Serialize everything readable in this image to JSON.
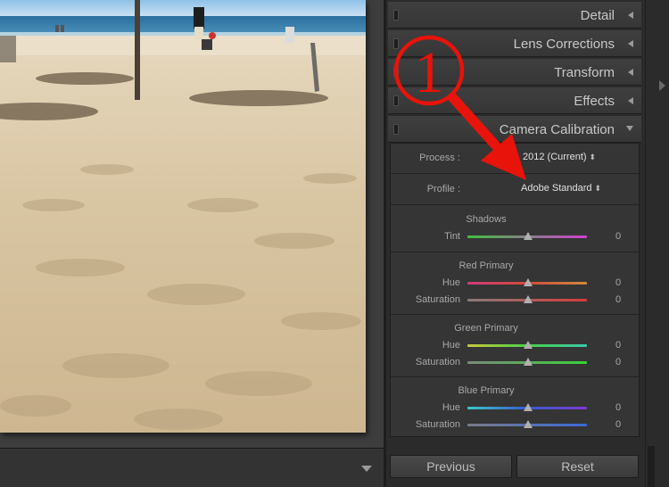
{
  "panel": {
    "sections": [
      {
        "title": "Detail",
        "state": "collapsed"
      },
      {
        "title": "Lens Corrections",
        "state": "collapsed"
      },
      {
        "title": "Transform",
        "state": "collapsed"
      },
      {
        "title": "Effects",
        "state": "collapsed"
      },
      {
        "title": "Camera Calibration",
        "state": "expanded"
      }
    ],
    "calibration": {
      "process": {
        "label": "Process :",
        "value": "2012 (Current)"
      },
      "profile": {
        "label": "Profile :",
        "value": "Adobe Standard"
      },
      "shadows": {
        "title": "Shadows",
        "tint": {
          "label": "Tint",
          "value": "0"
        }
      },
      "red_primary": {
        "title": "Red Primary",
        "hue": {
          "label": "Hue",
          "value": "0"
        },
        "saturation": {
          "label": "Saturation",
          "value": "0"
        }
      },
      "green_primary": {
        "title": "Green Primary",
        "hue": {
          "label": "Hue",
          "value": "0"
        },
        "saturation": {
          "label": "Saturation",
          "value": "0"
        }
      },
      "blue_primary": {
        "title": "Blue Primary",
        "hue": {
          "label": "Hue",
          "value": "0"
        },
        "saturation": {
          "label": "Saturation",
          "value": "0"
        }
      }
    },
    "buttons": {
      "previous": "Previous",
      "reset": "Reset"
    }
  },
  "annotation": {
    "number": "1",
    "color": "#e8130a"
  },
  "icons": {
    "collapsed_indicator": "triangle-left-icon",
    "expanded_indicator": "triangle-down-icon",
    "select_arrows": "updown-arrows-icon",
    "panel_switch": "panel-switch-icon",
    "filmstrip_toggle": "triangle-down-icon",
    "right_rail": "triangle-right-icon"
  },
  "photo": {
    "subject": "sandy beach with umbrella poles and people near the sea"
  }
}
